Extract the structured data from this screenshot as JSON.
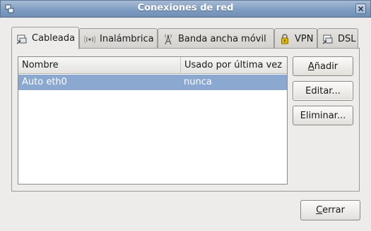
{
  "window": {
    "title": "Conexiones de red"
  },
  "tabs": [
    {
      "label": "Cableada",
      "icon": "wired-network-icon",
      "active": true
    },
    {
      "label": "Inalámbrica",
      "icon": "wireless-icon",
      "active": false
    },
    {
      "label": "Banda ancha móvil",
      "icon": "mobile-antenna-icon",
      "active": false
    },
    {
      "label": "VPN",
      "icon": "lock-icon",
      "active": false
    },
    {
      "label": "DSL",
      "icon": "dsl-network-icon",
      "active": false
    }
  ],
  "list": {
    "columns": [
      "Nombre",
      "Usado por última vez"
    ],
    "rows": [
      {
        "name": "Auto eth0",
        "last_used": "nunca",
        "selected": true
      }
    ],
    "selection_color": "#8aa8d0"
  },
  "buttons": {
    "add": {
      "mnemonic": "A",
      "rest": "ñadir"
    },
    "edit": "Editar...",
    "delete": "Eliminar...",
    "close": {
      "mnemonic": "C",
      "rest": "errar"
    }
  },
  "colors": {
    "titlebar": "#7f9dc1",
    "background": "#edeceb"
  }
}
